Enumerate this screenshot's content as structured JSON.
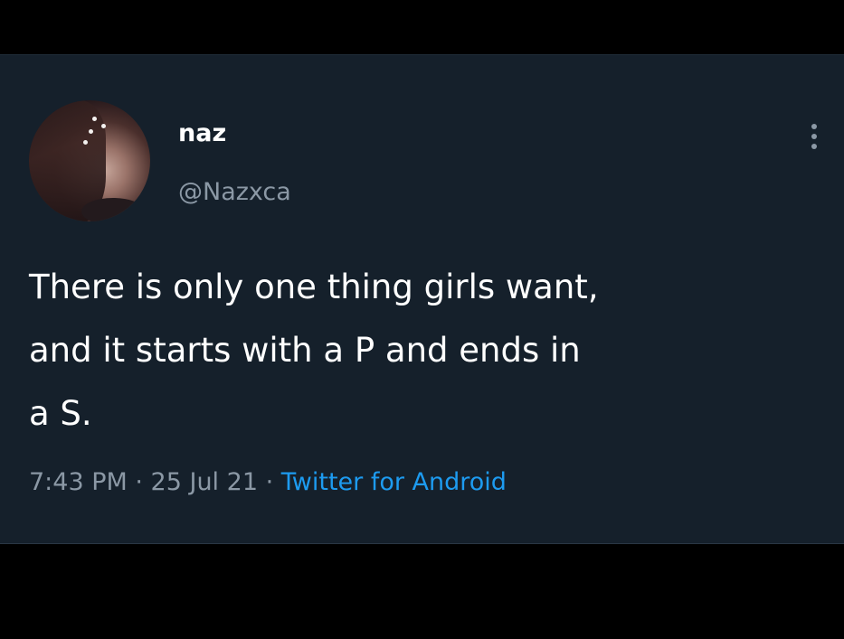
{
  "tweet": {
    "display_name": "naz",
    "handle": "@Nazxca",
    "text": "There is only one thing girls want,\nand it starts with a P and ends in\na S.",
    "time": "7:43 PM",
    "separator": " · ",
    "date": "25 Jul 21",
    "source": "Twitter for Android"
  },
  "icons": {
    "more": "more-options-vertical-icon"
  },
  "colors": {
    "background": "#15202b",
    "text": "#ffffff",
    "secondary_text": "#8b98a5",
    "link": "#1d9bf0"
  }
}
